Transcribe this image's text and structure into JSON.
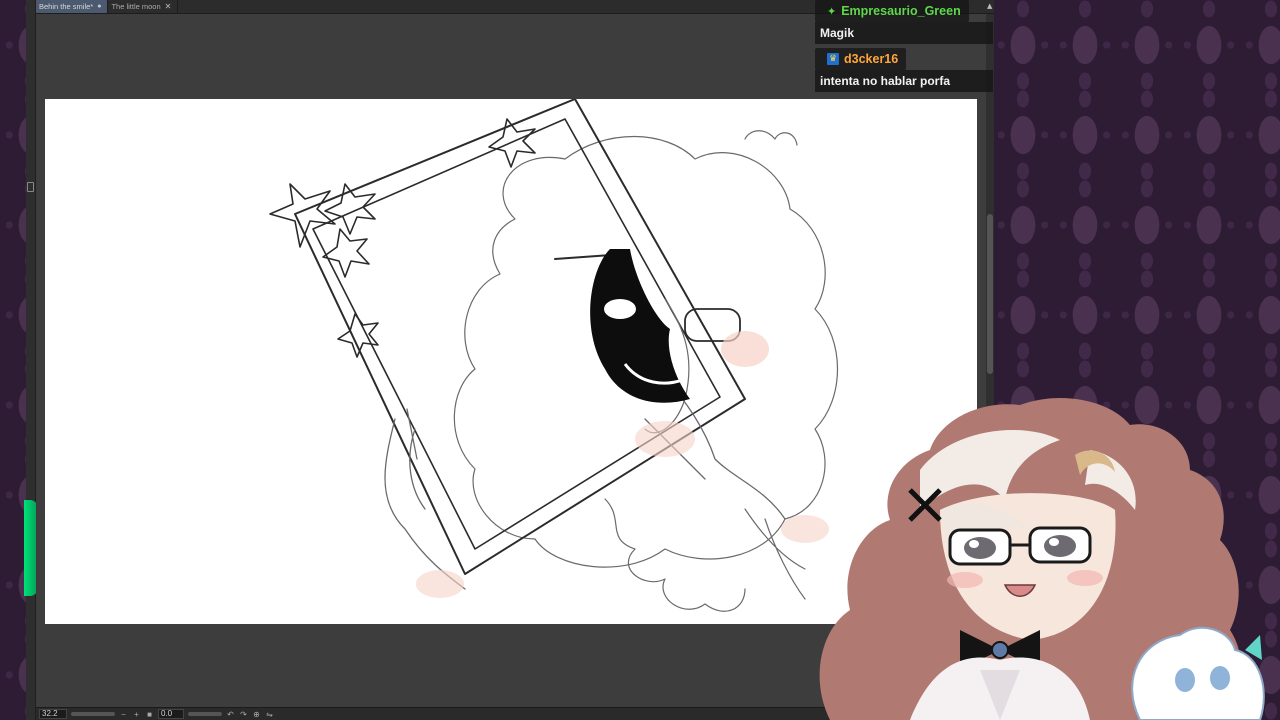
{
  "app": {
    "tabs": [
      {
        "label": "Behin the smile*",
        "active": true
      },
      {
        "label": "The little moon",
        "active": false
      }
    ],
    "status": {
      "zoom": "32.2",
      "angle": "0.0"
    }
  },
  "chat": {
    "messages": [
      {
        "username": "Empresaurio_Green",
        "name_color": "#5fd84b",
        "badge_icon": "green-sparkle-icon",
        "text": "Magik"
      },
      {
        "username": "d3cker16",
        "name_color": "#ffa63a",
        "badge_icon": "prime-badge-icon",
        "text": "intenta no hablar porfa"
      }
    ]
  },
  "colors": {
    "accent_green": "#00e27a",
    "wallpaper": "#2d1c33",
    "app_bg": "#3b3b3b"
  }
}
